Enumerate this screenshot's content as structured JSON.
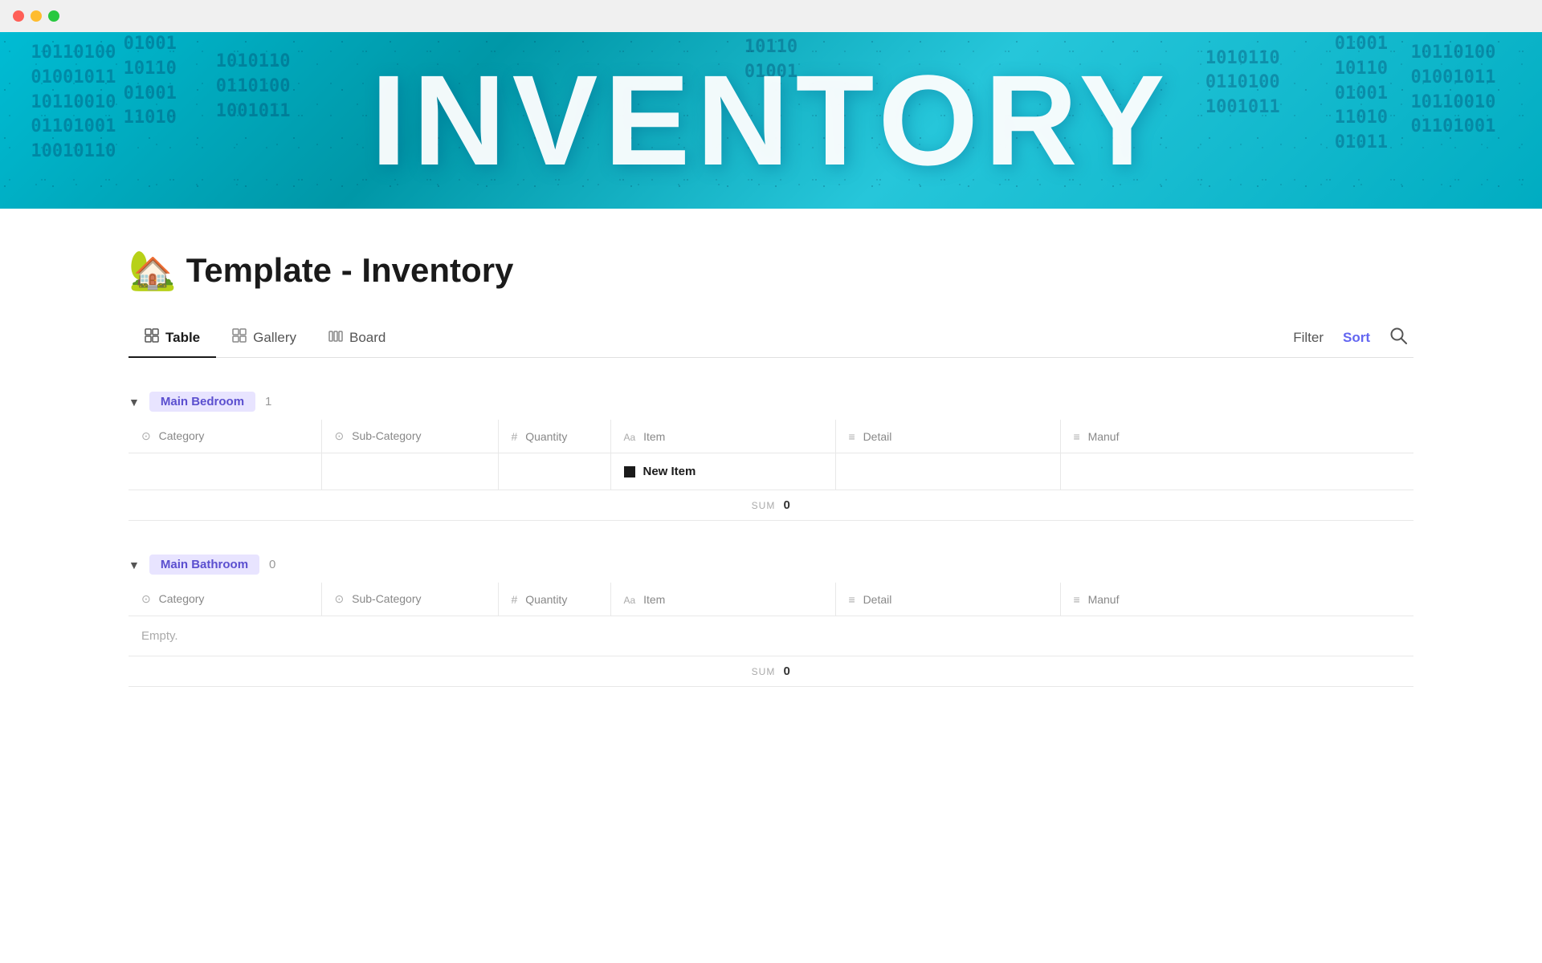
{
  "titlebar": {
    "traffic_lights": [
      "red",
      "yellow",
      "green"
    ]
  },
  "hero": {
    "title": "INVENTORY"
  },
  "page": {
    "emoji": "🏡",
    "title": "Template - Inventory"
  },
  "tabs": {
    "items": [
      {
        "id": "table",
        "label": "Table",
        "icon": "table-icon",
        "active": true
      },
      {
        "id": "gallery",
        "label": "Gallery",
        "icon": "gallery-icon",
        "active": false
      },
      {
        "id": "board",
        "label": "Board",
        "icon": "board-icon",
        "active": false
      }
    ],
    "actions": [
      {
        "id": "filter",
        "label": "Filter",
        "active": false
      },
      {
        "id": "sort",
        "label": "Sort",
        "active": true
      },
      {
        "id": "search",
        "label": "🔍",
        "active": false
      }
    ]
  },
  "groups": [
    {
      "id": "main-bedroom",
      "label": "Main Bedroom",
      "count": 1,
      "columns": [
        {
          "id": "category",
          "label": "Category",
          "icon_type": "circle-select"
        },
        {
          "id": "sub-category",
          "label": "Sub-Category",
          "icon_type": "circle-select"
        },
        {
          "id": "quantity",
          "label": "Quantity",
          "icon_type": "hash"
        },
        {
          "id": "item",
          "label": "Item",
          "icon_type": "aa"
        },
        {
          "id": "detail",
          "label": "Detail",
          "icon_type": "lines"
        },
        {
          "id": "manuf",
          "label": "Manuf",
          "icon_type": "lines"
        }
      ],
      "rows": [
        {
          "category": "",
          "sub_category": "",
          "quantity": "",
          "item": "New Item",
          "detail": "",
          "manuf": ""
        }
      ],
      "sum_label": "SUM",
      "sum_value": "0",
      "empty": false
    },
    {
      "id": "main-bathroom",
      "label": "Main Bathroom",
      "count": 0,
      "columns": [
        {
          "id": "category",
          "label": "Category",
          "icon_type": "circle-select"
        },
        {
          "id": "sub-category",
          "label": "Sub-Category",
          "icon_type": "circle-select"
        },
        {
          "id": "quantity",
          "label": "Quantity",
          "icon_type": "hash"
        },
        {
          "id": "item",
          "label": "Item",
          "icon_type": "aa"
        },
        {
          "id": "detail",
          "label": "Detail",
          "icon_type": "lines"
        },
        {
          "id": "manuf",
          "label": "Manuf",
          "icon_type": "lines"
        }
      ],
      "rows": [],
      "sum_label": "SUM",
      "sum_value": "0",
      "empty": true,
      "empty_text": "Empty."
    }
  ]
}
